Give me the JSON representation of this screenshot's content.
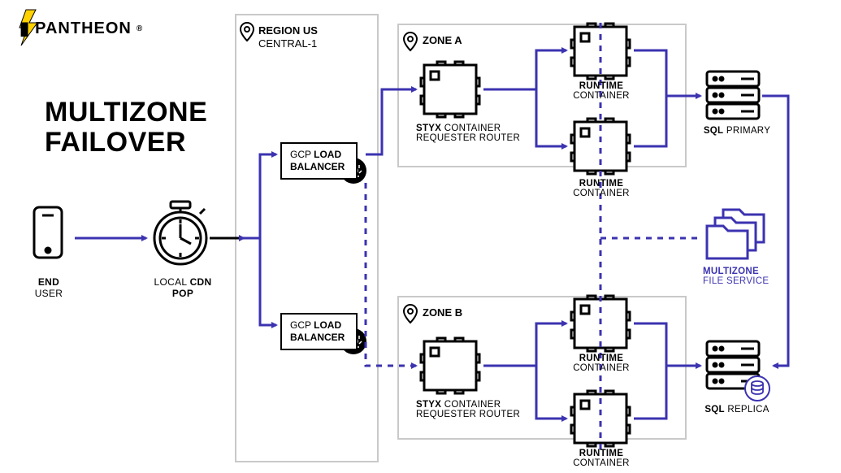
{
  "brand": "PANTHEON",
  "title_line1": "MULTIZONE",
  "title_line2": "FAILOVER",
  "end_user": {
    "bold": "END",
    "rest": " USER"
  },
  "cdn_pop": {
    "rest": "LOCAL ",
    "bold": "CDN POP"
  },
  "region": {
    "bold": "REGION US",
    "rest": "CENTRAL-1"
  },
  "gcp_a": {
    "rest1": "GCP ",
    "bold1": "LOAD",
    "bold2": "BALANCER"
  },
  "gcp_b": {
    "rest1": "GCP ",
    "bold1": "LOAD",
    "bold2": "BALANCER"
  },
  "zone_a": "ZONE A",
  "zone_b": "ZONE B",
  "styx_a": {
    "bold": "STYX",
    "rest1": " CONTAINER",
    "rest2": "REQUESTER ROUTER"
  },
  "styx_b": {
    "bold": "STYX",
    "rest1": " CONTAINER",
    "rest2": "REQUESTER ROUTER"
  },
  "runtime_a1": {
    "bold": "RUNTIME",
    "rest": "CONTAINER"
  },
  "runtime_a2": {
    "bold": "RUNTIME",
    "rest": "CONTAINER"
  },
  "runtime_b1": {
    "bold": "RUNTIME",
    "rest": "CONTAINER"
  },
  "runtime_b2": {
    "bold": "RUNTIME",
    "rest": "CONTAINER"
  },
  "sql_primary": {
    "bold": "SQL",
    "rest": " PRIMARY"
  },
  "sql_replica": {
    "bold": "SQL",
    "rest": " REPLICA"
  },
  "multizone_fs": {
    "bold": "MULTIZONE",
    "rest": "FILE SERVICE"
  },
  "colors": {
    "purple": "#3b33b0",
    "black": "#000000"
  }
}
